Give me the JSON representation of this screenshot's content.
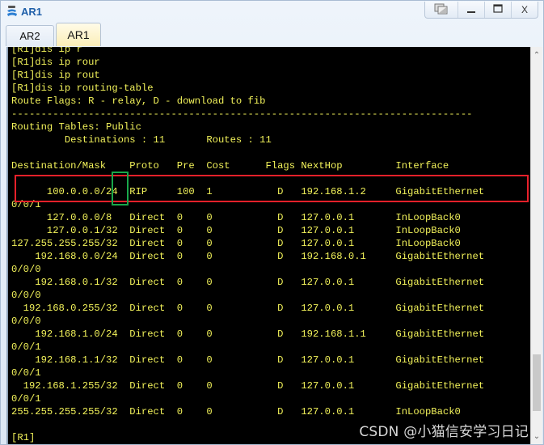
{
  "window": {
    "title": "AR1",
    "controls": {
      "restore_icon": "restore-window-icon",
      "minimize_label": "—",
      "maximize_label": "▭",
      "close_label": "X"
    }
  },
  "tabs": [
    {
      "label": "AR2",
      "active": false
    },
    {
      "label": "AR1",
      "active": true
    }
  ],
  "terminal": {
    "lines": [
      "[R1]dis ip r",
      "[R1]dis ip rour",
      "[R1]dis ip rout",
      "[R1]dis ip routing-table",
      "Route Flags: R - relay, D - download to fib",
      "------------------------------------------------------------------------------",
      "Routing Tables: Public",
      "         Destinations : 11       Routes : 11",
      "",
      "Destination/Mask    Proto   Pre  Cost      Flags NextHop         Interface",
      "",
      "      100.0.0.0/24  RIP     100  1           D   192.168.1.2     GigabitEthernet",
      "0/0/1",
      "      127.0.0.0/8   Direct  0    0           D   127.0.0.1       InLoopBack0",
      "      127.0.0.1/32  Direct  0    0           D   127.0.0.1       InLoopBack0",
      "127.255.255.255/32  Direct  0    0           D   127.0.0.1       InLoopBack0",
      "    192.168.0.0/24  Direct  0    0           D   192.168.0.1     GigabitEthernet",
      "0/0/0",
      "    192.168.0.1/32  Direct  0    0           D   127.0.0.1       GigabitEthernet",
      "0/0/0",
      "  192.168.0.255/32  Direct  0    0           D   127.0.0.1       GigabitEthernet",
      "0/0/0",
      "    192.168.1.0/24  Direct  0    0           D   192.168.1.1     GigabitEthernet",
      "0/0/1",
      "    192.168.1.1/32  Direct  0    0           D   127.0.0.1       GigabitEthernet",
      "0/0/1",
      "  192.168.1.255/32  Direct  0    0           D   127.0.0.1       GigabitEthernet",
      "0/0/1",
      "255.255.255.255/32  Direct  0    0           D   127.0.0.1       InLoopBack0",
      "",
      "[R1]"
    ]
  },
  "routing_table": {
    "flags_legend": "Route Flags: R - relay, D - download to fib",
    "table_name": "Public",
    "destinations": 11,
    "routes": 11,
    "columns": [
      "Destination/Mask",
      "Proto",
      "Pre",
      "Cost",
      "Flags",
      "NextHop",
      "Interface"
    ],
    "rows": [
      [
        "100.0.0.0/24",
        "RIP",
        "100",
        "1",
        "D",
        "192.168.1.2",
        "GigabitEthernet0/0/1"
      ],
      [
        "127.0.0.0/8",
        "Direct",
        "0",
        "0",
        "D",
        "127.0.0.1",
        "InLoopBack0"
      ],
      [
        "127.0.0.1/32",
        "Direct",
        "0",
        "0",
        "D",
        "127.0.0.1",
        "InLoopBack0"
      ],
      [
        "127.255.255.255/32",
        "Direct",
        "0",
        "0",
        "D",
        "127.0.0.1",
        "InLoopBack0"
      ],
      [
        "192.168.0.0/24",
        "Direct",
        "0",
        "0",
        "D",
        "192.168.0.1",
        "GigabitEthernet0/0/0"
      ],
      [
        "192.168.0.1/32",
        "Direct",
        "0",
        "0",
        "D",
        "127.0.0.1",
        "GigabitEthernet0/0/0"
      ],
      [
        "192.168.0.255/32",
        "Direct",
        "0",
        "0",
        "D",
        "127.0.0.1",
        "GigabitEthernet0/0/0"
      ],
      [
        "192.168.1.0/24",
        "Direct",
        "0",
        "0",
        "D",
        "192.168.1.1",
        "GigabitEthernet0/0/1"
      ],
      [
        "192.168.1.1/32",
        "Direct",
        "0",
        "0",
        "D",
        "127.0.0.1",
        "GigabitEthernet0/0/1"
      ],
      [
        "192.168.1.255/32",
        "Direct",
        "0",
        "0",
        "D",
        "127.0.0.1",
        "GigabitEthernet0/0/1"
      ],
      [
        "255.255.255.255/32",
        "Direct",
        "0",
        "0",
        "D",
        "127.0.0.1",
        "InLoopBack0"
      ]
    ]
  },
  "annotations": {
    "red_box": "highlighted RIP route row",
    "green_box": "highlighted mask /24"
  },
  "scrollbar": {
    "position_fraction": 0.95
  },
  "watermark": "CSDN @小猫信安学习日记",
  "colors": {
    "terminal_bg": "#000000",
    "terminal_text": "#f2f25a",
    "title_text": "#1f5fa9",
    "highlight_red": "#e8202a",
    "highlight_green": "#19a84a"
  }
}
